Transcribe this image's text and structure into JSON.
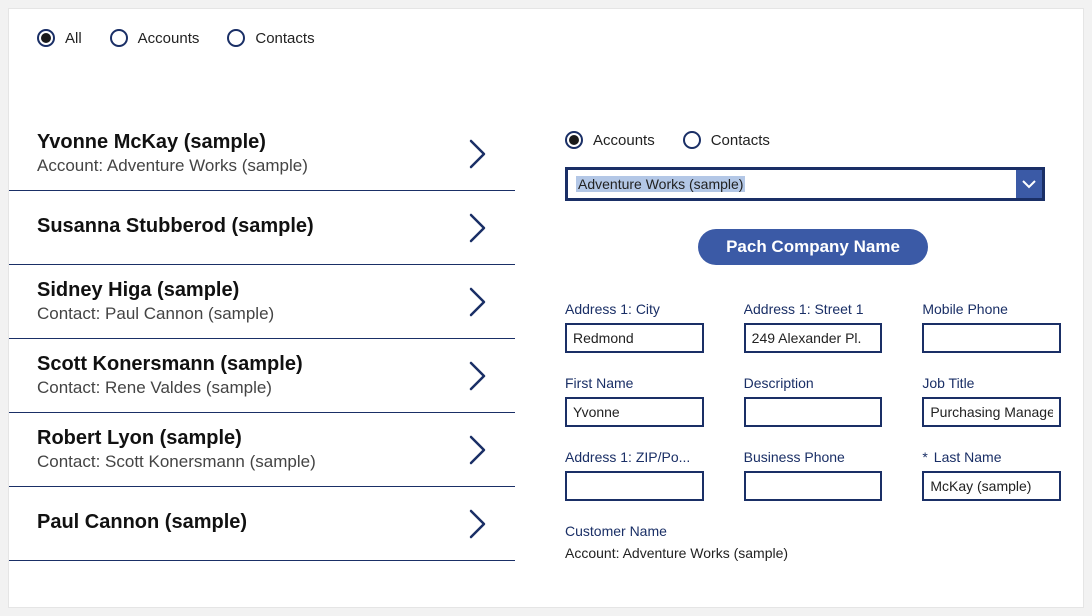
{
  "topFilters": [
    {
      "label": "All",
      "selected": true
    },
    {
      "label": "Accounts",
      "selected": false
    },
    {
      "label": "Contacts",
      "selected": false
    }
  ],
  "listItems": [
    {
      "title": "Yvonne McKay (sample)",
      "sub": "Account: Adventure Works (sample)"
    },
    {
      "title": "Susanna Stubberod (sample)",
      "sub": ""
    },
    {
      "title": "Sidney Higa (sample)",
      "sub": "Contact: Paul Cannon (sample)"
    },
    {
      "title": "Scott Konersmann (sample)",
      "sub": "Contact: Rene Valdes (sample)"
    },
    {
      "title": "Robert Lyon (sample)",
      "sub": "Contact: Scott Konersmann (sample)"
    },
    {
      "title": "Paul Cannon (sample)",
      "sub": ""
    }
  ],
  "detail": {
    "radios": [
      {
        "label": "Accounts",
        "selected": true
      },
      {
        "label": "Contacts",
        "selected": false
      }
    ],
    "dropdownValue": "Adventure Works (sample)",
    "buttonLabel": "Pach Company Name",
    "fields": [
      {
        "label": "Address 1: City",
        "value": "Redmond",
        "required": false
      },
      {
        "label": "Address 1: Street 1",
        "value": "249 Alexander Pl.",
        "required": false
      },
      {
        "label": "Mobile Phone",
        "value": "",
        "required": false
      },
      {
        "label": "First Name",
        "value": "Yvonne",
        "required": false
      },
      {
        "label": "Description",
        "value": "",
        "required": false
      },
      {
        "label": "Job Title",
        "value": "Purchasing Manager",
        "required": false
      },
      {
        "label": "Address 1: ZIP/Po...",
        "value": "",
        "required": false
      },
      {
        "label": "Business Phone",
        "value": "",
        "required": false
      },
      {
        "label": "Last Name",
        "value": "McKay (sample)",
        "required": true
      }
    ],
    "customerLabel": "Customer Name",
    "customerValue": "Account: Adventure Works (sample)"
  }
}
